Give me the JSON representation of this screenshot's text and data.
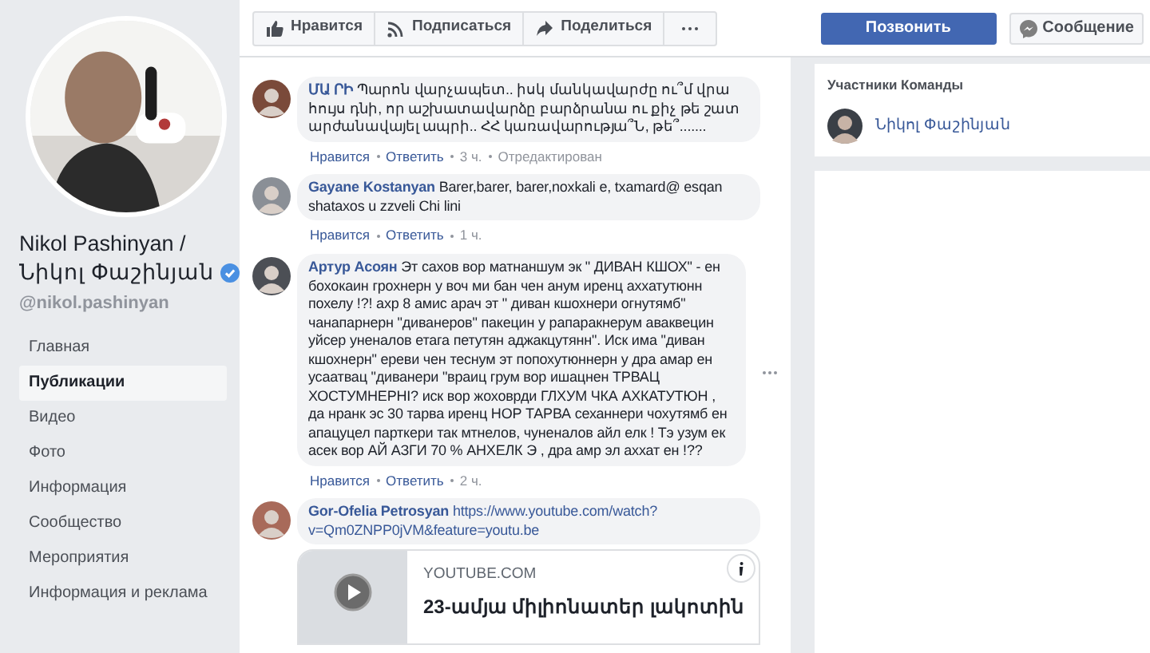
{
  "profile": {
    "name_lines": [
      "Nikol Pashinyan /",
      "Նիկոլ Փաշինյան"
    ],
    "verified": true,
    "handle": "@nikol.pashinyan"
  },
  "nav": [
    {
      "label": "Главная",
      "selected": false
    },
    {
      "label": "Публикации",
      "selected": true
    },
    {
      "label": "Видео",
      "selected": false
    },
    {
      "label": "Фото",
      "selected": false
    },
    {
      "label": "Информация",
      "selected": false
    },
    {
      "label": "Сообщество",
      "selected": false
    },
    {
      "label": "Мероприятия",
      "selected": false
    },
    {
      "label": "Информация и реклама",
      "selected": false
    }
  ],
  "page_actions": [
    {
      "kind": "like",
      "label": "Нравится"
    },
    {
      "kind": "follow",
      "label": "Подписаться"
    },
    {
      "kind": "share",
      "label": "Поделиться"
    },
    {
      "kind": "more"
    }
  ],
  "call_button": "Позвонить",
  "message_button": "Сообщение",
  "comments": [
    {
      "author": "ՄԱ ՐԻ",
      "text": "Պարոն վարչապետ.. իսկ մանկավարժը ու՞մ վրա հույս դնի, որ աշխատավարձը բարձրանա ու քիչ թե շատ արժանավայել ապրի.. ՀՀ կառավարությա՞Ն, թե՞.......",
      "actions": [
        "Нравится",
        "Ответить"
      ],
      "time": "3 ч.",
      "edited": "Отредактирован",
      "show_options": false
    },
    {
      "author": "Gayane Kostanyan",
      "text": "Barer,barer, barer,noxkali e, txamard@ esqan shataxos u zzveli Chi lini",
      "actions": [
        "Нравится",
        "Ответить"
      ],
      "time": "1 ч.",
      "show_options": false
    },
    {
      "author": "Артур Асоян",
      "text": "Эт сахов вор матнаншум эк \" ДИВАН КШОХ\" - ен бохокаин грохнерн у воч ми бан чен анум иренц аххатутюнн похелу !?! ахр 8 амис арач эт \" диван кшохнери огнутямб\" чанапарнерн \"диванеров\" пакецин у рапаракнерум аваквецин уйсер уненалов етага петутян аджакцутянн\". Иск има \"диван кшохнерн\" ереви чен теснум эт попохутюннерн у дра амар ен усаатвац \"диванери \"враиц грум вор ишацнен ТРВАЦ ХОСТУМНЕРНI? иск вор жоховрди ГЛХУМ ЧКА АХКАТУТЮН , да нранк эс 30 тарва иренц НОР ТАРВА сеханнери чохутямб ен апацуцел парткери так мтнелов, чуненалов айл елк ! Тэ узум ек асек вор АЙ АЗГИ 70 % АНХЕЛК Э , дра амр эл аххат ен !??",
      "actions": [
        "Нравится",
        "Ответить"
      ],
      "time": "2 ч.",
      "show_options": true
    },
    {
      "author": "Gor-Ofelia Petrosyan",
      "link_lines": [
        "https://www.youtube.com/watch?",
        "v=Qm0ZNPP0jVM&feature=youtu.be"
      ],
      "link_preview": {
        "source": "YOUTUBE.COM",
        "title": "23-ամյա միլիոնատեր լակոտին"
      },
      "show_options": false
    }
  ],
  "team": {
    "heading": "Участники Команды",
    "members": [
      {
        "name": "Նիկոլ Փաշինյան"
      }
    ]
  }
}
